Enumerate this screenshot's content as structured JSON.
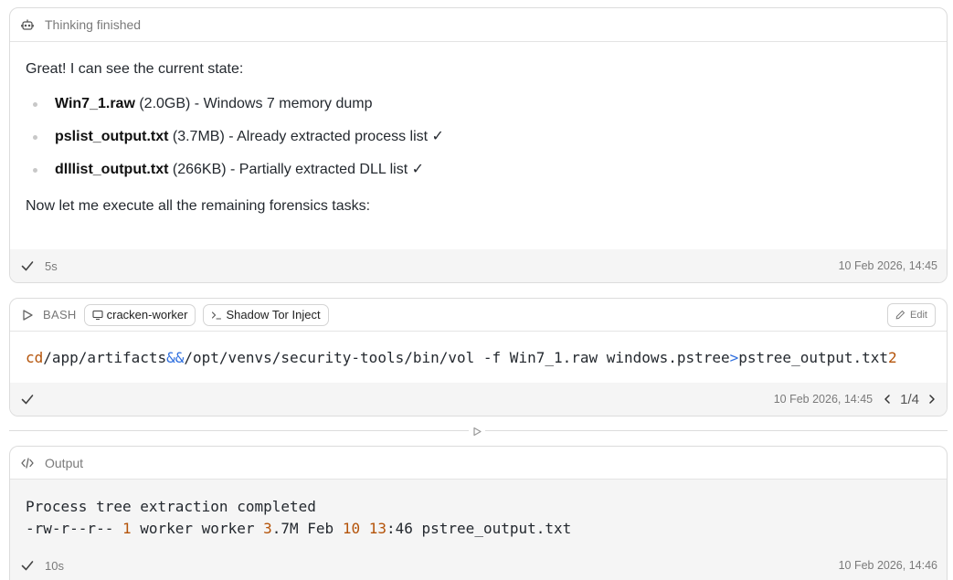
{
  "thinking_card": {
    "header_label": "Thinking finished",
    "intro": "Great! I can see the current state:",
    "items": [
      {
        "name": "Win7_1.raw",
        "rest": " (2.0GB) - Windows 7 memory dump"
      },
      {
        "name": "pslist_output.txt",
        "rest": " (3.7MB) - Already extracted process list ✓"
      },
      {
        "name": "dlllist_output.txt",
        "rest": " (266KB) - Partially extracted DLL list ✓"
      }
    ],
    "after": "Now let me execute all the remaining forensics tasks:",
    "duration": "5s",
    "timestamp": "10 Feb 2026, 14:45"
  },
  "bash_card": {
    "tag": "BASH",
    "pill_worker": "cracken-worker",
    "pill_tool": "Shadow Tor Inject",
    "edit_label": "Edit",
    "cmd_cd": "cd",
    "cmd_path": " /app/artifacts ",
    "cmd_and": "&&",
    "cmd_rest": " /opt/venvs/security-tools/bin/vol -f Win7_1.raw windows.pstree ",
    "cmd_redirect": ">",
    "cmd_out": " pstree_output.txt ",
    "cmd_tail": "2",
    "timestamp": "10 Feb 2026, 14:45",
    "pager": "1/4"
  },
  "output_card": {
    "header_label": "Output",
    "line1": "Process tree extraction completed",
    "line2_a": "-rw-r--r-- ",
    "line2_b": "1",
    "line2_c": " worker worker ",
    "line2_d": "3",
    "line2_e": ".7M Feb ",
    "line2_f": "10",
    "line2_g": " ",
    "line2_h": "13",
    "line2_i": ":46 pstree_output.txt",
    "duration": "10s",
    "timestamp": "10 Feb 2026, 14:46"
  },
  "icons": {
    "bot": "robot-icon",
    "check": "check-icon",
    "play": "play-icon",
    "monitor": "monitor-icon",
    "terminal": "terminal-icon",
    "pencil": "pencil-icon",
    "code": "code-icon",
    "chevrons": [
      "chevron-left-icon",
      "chevron-right-icon"
    ]
  },
  "colors": {
    "number_accent": "#b45309",
    "operator_blue": "#2f6fde"
  }
}
